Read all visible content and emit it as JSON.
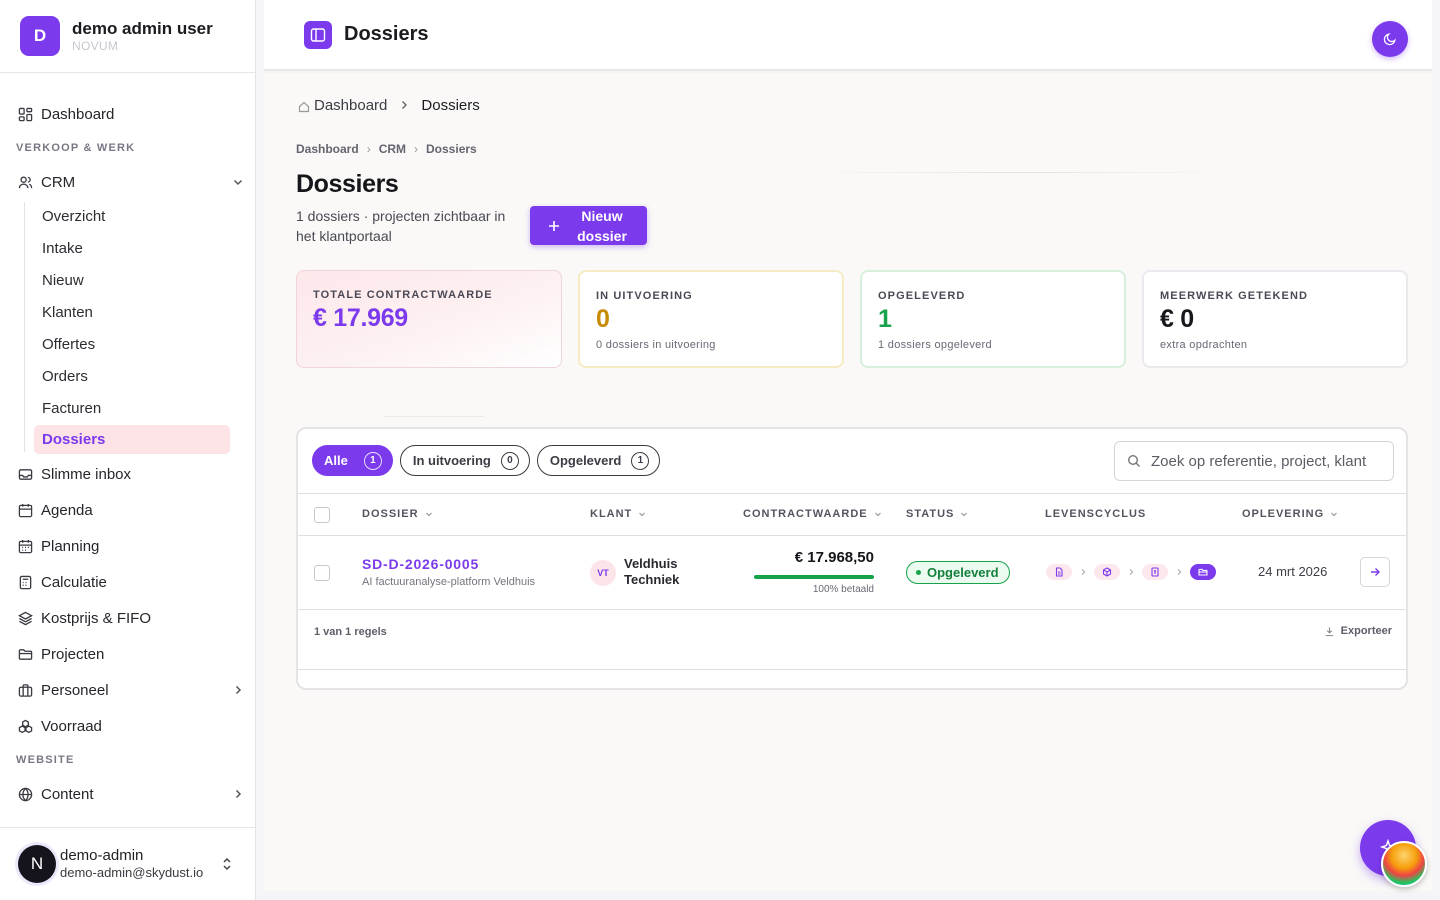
{
  "org": {
    "initial": "D",
    "name": "demo admin user",
    "subtitle": "NOVUM"
  },
  "nav": {
    "dashboard": "Dashboard",
    "section_sales": "VERKOOP & WERK",
    "crm": "CRM",
    "crm_items": [
      "Overzicht",
      "Intake",
      "Nieuw",
      "Klanten",
      "Offertes",
      "Orders",
      "Facturen",
      "Dossiers"
    ],
    "items": [
      "Slimme inbox",
      "Agenda",
      "Planning",
      "Calculatie",
      "Kostprijs & FIFO",
      "Projecten",
      "Personeel",
      "Voorraad"
    ],
    "section_website": "WEBSITE",
    "content": "Content"
  },
  "user": {
    "initial": "N",
    "name": "demo-admin",
    "email": "demo-admin@skydust.io"
  },
  "topbar": {
    "title": "Dossiers"
  },
  "breadcrumb_main": [
    "Dashboard",
    "Dossiers"
  ],
  "breadcrumb_small": [
    "Dashboard",
    "CRM",
    "Dossiers"
  ],
  "page": {
    "title": "Dossiers",
    "subtitle": "1 dossiers · projecten zichtbaar in het klantportaal",
    "new_button": "Nieuw dossier"
  },
  "kpis": [
    {
      "label": "TOTALE CONTRACTWAARDE",
      "value": "€ 17.969",
      "sub": ""
    },
    {
      "label": "IN UITVOERING",
      "value": "0",
      "sub": "0 dossiers in uitvoering"
    },
    {
      "label": "OPGELEVERD",
      "value": "1",
      "sub": "1 dossiers opgeleverd"
    },
    {
      "label": "MEERWERK GETEKEND",
      "value": "€ 0",
      "sub": "extra opdrachten"
    }
  ],
  "filters": [
    {
      "label": "Alle",
      "count": "1"
    },
    {
      "label": "In uitvoering",
      "count": "0"
    },
    {
      "label": "Opgeleverd",
      "count": "1"
    }
  ],
  "search": {
    "placeholder": "Zoek op referentie, project, klant"
  },
  "table": {
    "columns": [
      "DOSSIER",
      "KLANT",
      "CONTRACTWAARDE",
      "STATUS",
      "LEVENSCYCLUS",
      "OPLEVERING"
    ],
    "rows": [
      {
        "ref": "SD-D-2026-0005",
        "desc": "AI factuuranalyse-platform Veldhuis",
        "client_initials": "VT",
        "client": "Veldhuis Techniek",
        "amount": "€ 17.968,50",
        "paid_fraction": 1.0,
        "paid_label": "100% betaald",
        "status": "Opgeleverd",
        "lifecycle": [
          "file-icon",
          "box-icon",
          "invoice-icon",
          "folder-open-icon"
        ],
        "delivery": "24 mrt 2026"
      }
    ],
    "row_count": "1 van 1 regels",
    "export": "Exporteer"
  },
  "colors": {
    "accent": "#7c3aed",
    "success": "#16a34a",
    "warning": "#c88a00"
  }
}
